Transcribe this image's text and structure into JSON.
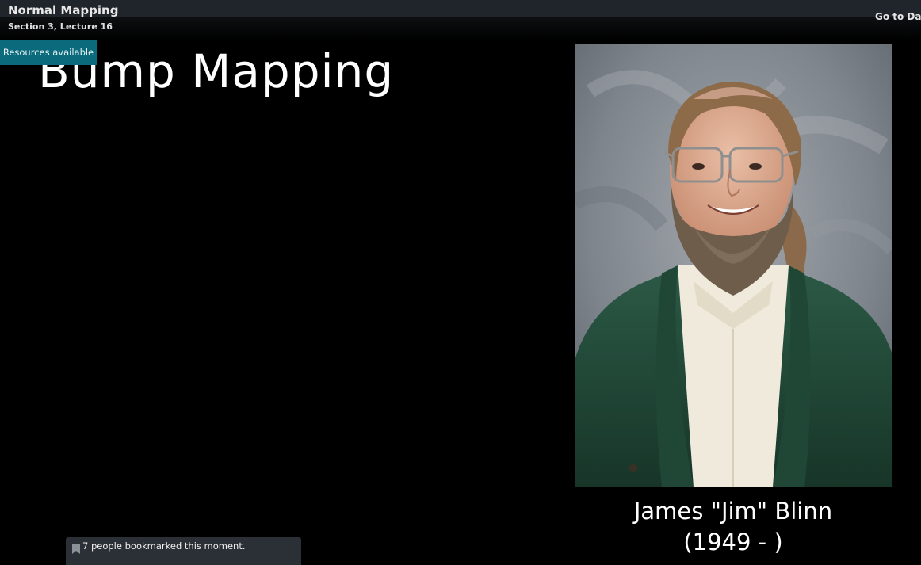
{
  "header": {
    "lecture_title": "Normal Mapping",
    "lecture_subtitle": "Section 3, Lecture 16",
    "goto_dashboard_label": "Go to Das"
  },
  "resources": {
    "badge_label": "Resources available"
  },
  "slide": {
    "title": "Bump Mapping",
    "portrait_caption_name": "James \"Jim\" Blinn",
    "portrait_caption_years": "(1949 - )"
  },
  "bookmark": {
    "icon": "bookmark-icon",
    "message": "7 people bookmarked this moment."
  },
  "colors": {
    "background": "#000000",
    "header_bar": "#20242b",
    "resources_badge": "#0b6b7c",
    "toast": "#2b2f36"
  }
}
